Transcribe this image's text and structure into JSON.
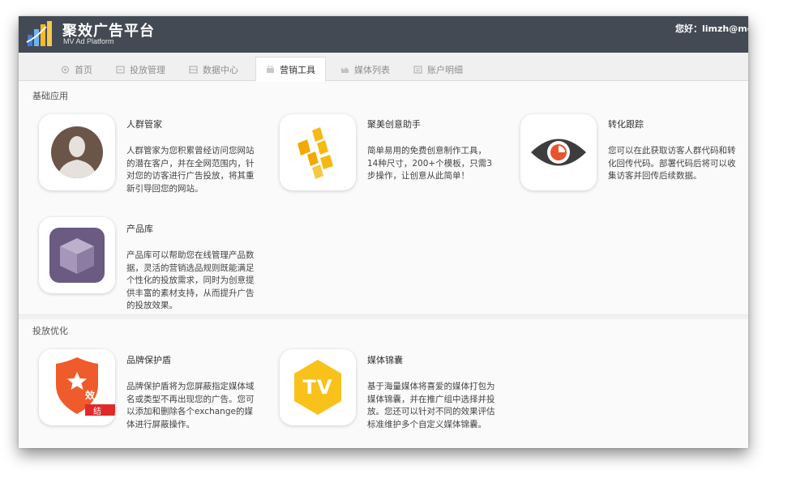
{
  "header": {
    "brand_title": "聚效广告平台",
    "brand_subtitle": "MV Ad Platform",
    "greeting": "您好：limzh@mee"
  },
  "nav": {
    "tabs": [
      {
        "label": "首页",
        "icon": "home-icon"
      },
      {
        "label": "投放管理",
        "icon": "campaign-icon"
      },
      {
        "label": "数据中心",
        "icon": "data-icon"
      },
      {
        "label": "营销工具",
        "icon": "tools-icon",
        "active": true
      },
      {
        "label": "媒体列表",
        "icon": "media-icon"
      },
      {
        "label": "账户明细",
        "icon": "account-icon"
      }
    ]
  },
  "sections": {
    "basic": "基础应用",
    "optimize": "投放优化"
  },
  "cards": {
    "audience": {
      "title": "人群管家",
      "desc": "人群管家为您积累曾经访问您网站的潜在客户，并在全网范围内，针对您的访客进行广告投放，将其重新引导回您的网站。"
    },
    "creative": {
      "title": "聚美创意助手",
      "desc": "简单易用的免费创意制作工具，14种尺寸，200+个模板，只需3步操作，让创意从此简单！"
    },
    "conversion": {
      "title": "转化跟踪",
      "desc": "您可以在此获取访客人群代码和转化回传代码。部署代码后将可以收集访客并回传后续数据。"
    },
    "products": {
      "title": "产品库",
      "desc": "产品库可以帮助您在线管理产品数据，灵活的营销选品规则既能满足个性化的投放需求，同时为创意提供丰富的素材支持，从而提升广告的投放效果。"
    },
    "brand_shield": {
      "title": "品牌保护盾",
      "desc": "品牌保护盾将为您屏蔽指定媒体域名或类型不再出现您的广告。您可以添加和删除各个exchange的媒体进行屏蔽操作。",
      "badge_text": "效",
      "ribbon_text": "结"
    },
    "media_bag": {
      "title": "媒体锦囊",
      "desc": "基于海量媒体将喜爱的媒体打包为媒体锦囊，并在推广组中选择并投放。您还可以针对不同的效果评估标准维护多个自定义媒体锦囊。",
      "logo_text": "TV"
    }
  },
  "colors": {
    "topbar": "#434a54",
    "shield": "#ef5b2b",
    "ribbon": "#e02a2a",
    "creative": "#f5b915",
    "tv": "#f8c21a",
    "box": "#6b5a82",
    "eye": "#3d3d3d",
    "eye_pupil": "#e8542e"
  }
}
